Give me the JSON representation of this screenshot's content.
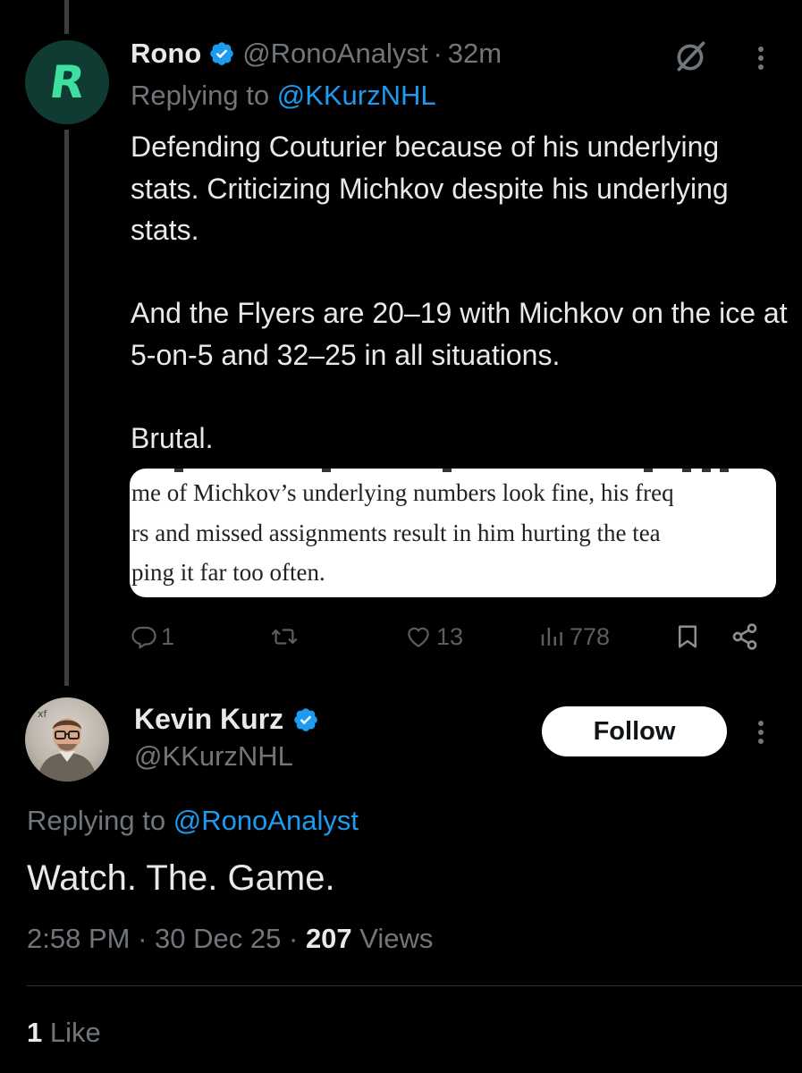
{
  "reply_tweet": {
    "author_name": "Rono",
    "author_handle": "@RonoAnalyst",
    "time_ago": "32m",
    "separator": "·",
    "replying_prefix": "Replying to",
    "replying_to": "@KKurzNHL",
    "avatar_letter": "R",
    "body": [
      "Defending Couturier because of his underlying stats. Criticizing Michkov despite his underlying stats.",
      "And the Flyers are 20–19 with Michkov on the ice at 5-on-5 and 32–25 in all situations.",
      "Brutal."
    ],
    "quote_image_lines": [
      "me of Michkov’s underlying numbers look fine, his freq",
      "rs and missed assignments result in him hurting the tea",
      "ping it far too often."
    ],
    "actions": {
      "replies": "1",
      "retweets": "",
      "likes": "13",
      "views": "778"
    }
  },
  "main_tweet": {
    "author_name": "Kevin Kurz",
    "author_handle": "@KKurzNHL",
    "follow_label": "Follow",
    "replying_prefix": "Replying to",
    "replying_to": "@RonoAnalyst",
    "text": "Watch. The. Game.",
    "time": "2:58 PM",
    "date": "30 Dec 25",
    "separator": "·",
    "views_count": "207",
    "views_label": "Views",
    "likes_count": "1",
    "likes_label": "Like"
  },
  "colors": {
    "background": "#000000",
    "text": "#e7e9ea",
    "muted": "#71767b",
    "link": "#1d9bf0",
    "verified": "#1d9bf0",
    "avatar_r_bg": "#0f3b33",
    "avatar_r_fg": "#3ee0a0"
  },
  "icons": [
    "verified-badge-icon",
    "grok-icon",
    "more-icon",
    "reply-icon",
    "retweet-icon",
    "like-icon",
    "views-icon",
    "bookmark-icon",
    "share-icon"
  ]
}
